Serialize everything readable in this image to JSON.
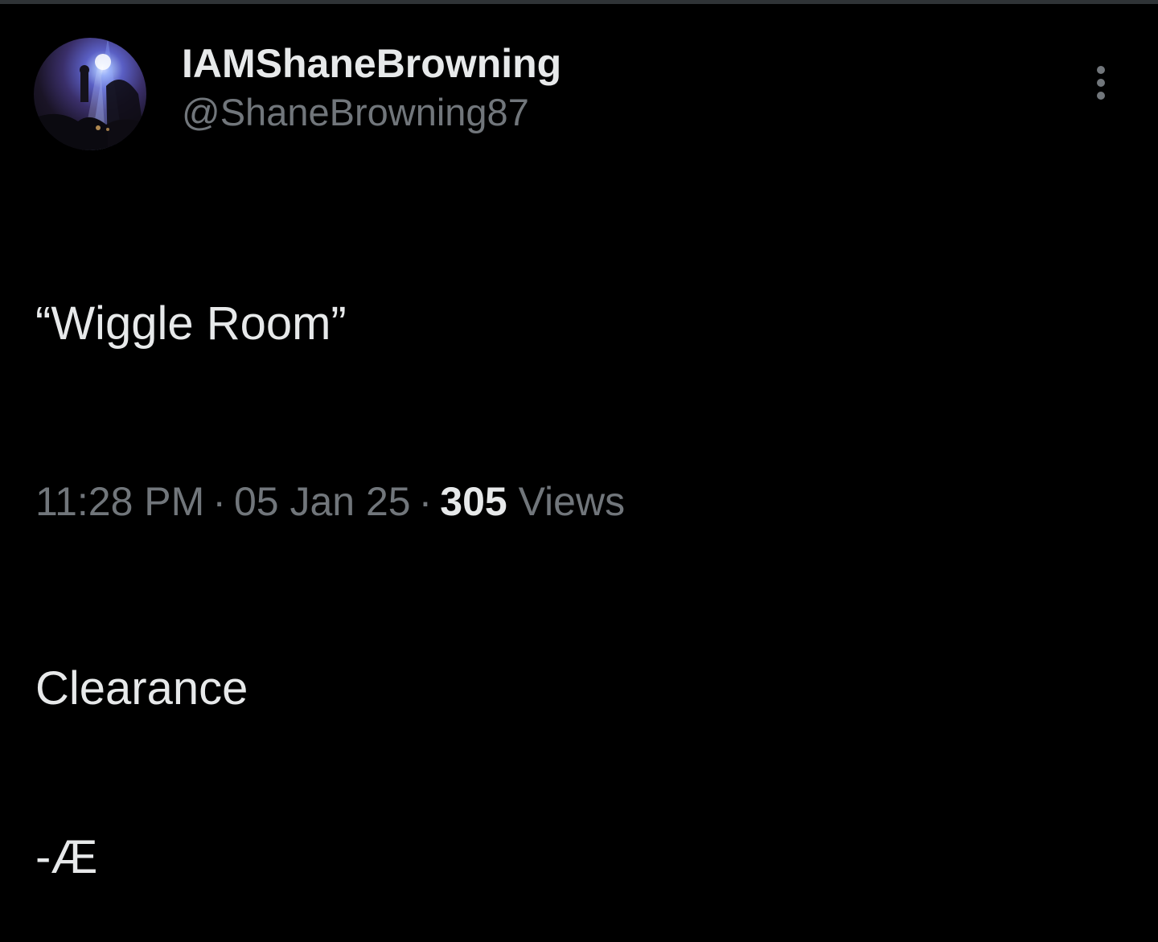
{
  "author": {
    "display_name": "IAMShaneBrowning",
    "handle": "@ShaneBrowning87"
  },
  "icons": {
    "more": "more-vertical-icon"
  },
  "tweet": {
    "lines": [
      "“Wiggle Room”",
      "",
      "Clearance",
      "-Æ"
    ]
  },
  "meta": {
    "time": "11:28 PM",
    "separator": "·",
    "date": "05 Jan 25",
    "views_count": "305",
    "views_label": "Views"
  },
  "colors": {
    "background": "#000000",
    "primary_text": "#e7e9ea",
    "secondary_text": "#71767b",
    "divider": "#2f3336"
  }
}
